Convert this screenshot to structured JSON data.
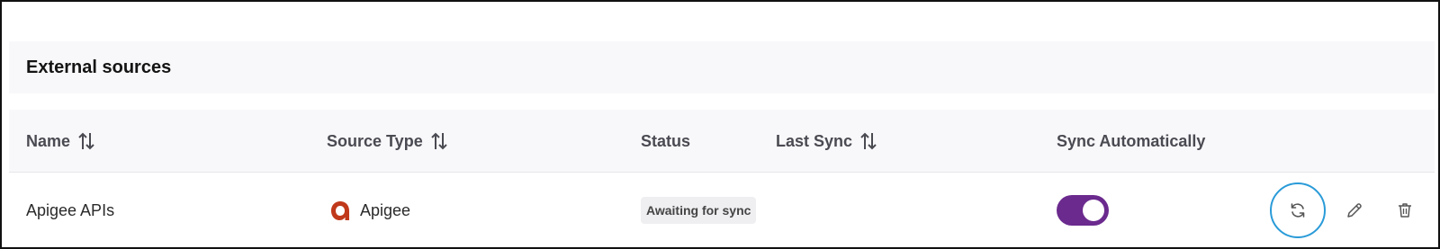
{
  "section": {
    "title": "External sources"
  },
  "columns": {
    "name": "Name",
    "source_type": "Source Type",
    "status": "Status",
    "last_sync": "Last Sync",
    "sync_auto": "Sync Automatically"
  },
  "rows": [
    {
      "name": "Apigee APIs",
      "source_type": "Apigee",
      "status": "Awaiting for sync",
      "last_sync": "",
      "sync_automatically": true
    }
  ],
  "colors": {
    "toggle_on": "#6b2a8e",
    "apigee_brand": "#c0391b",
    "focus_ring": "#2a9bd8"
  },
  "icons": {
    "sort": "sort-arrows-icon",
    "source_logo": "apigee-logo-icon",
    "sync": "refresh-icon",
    "edit": "pencil-icon",
    "delete": "trash-icon"
  }
}
